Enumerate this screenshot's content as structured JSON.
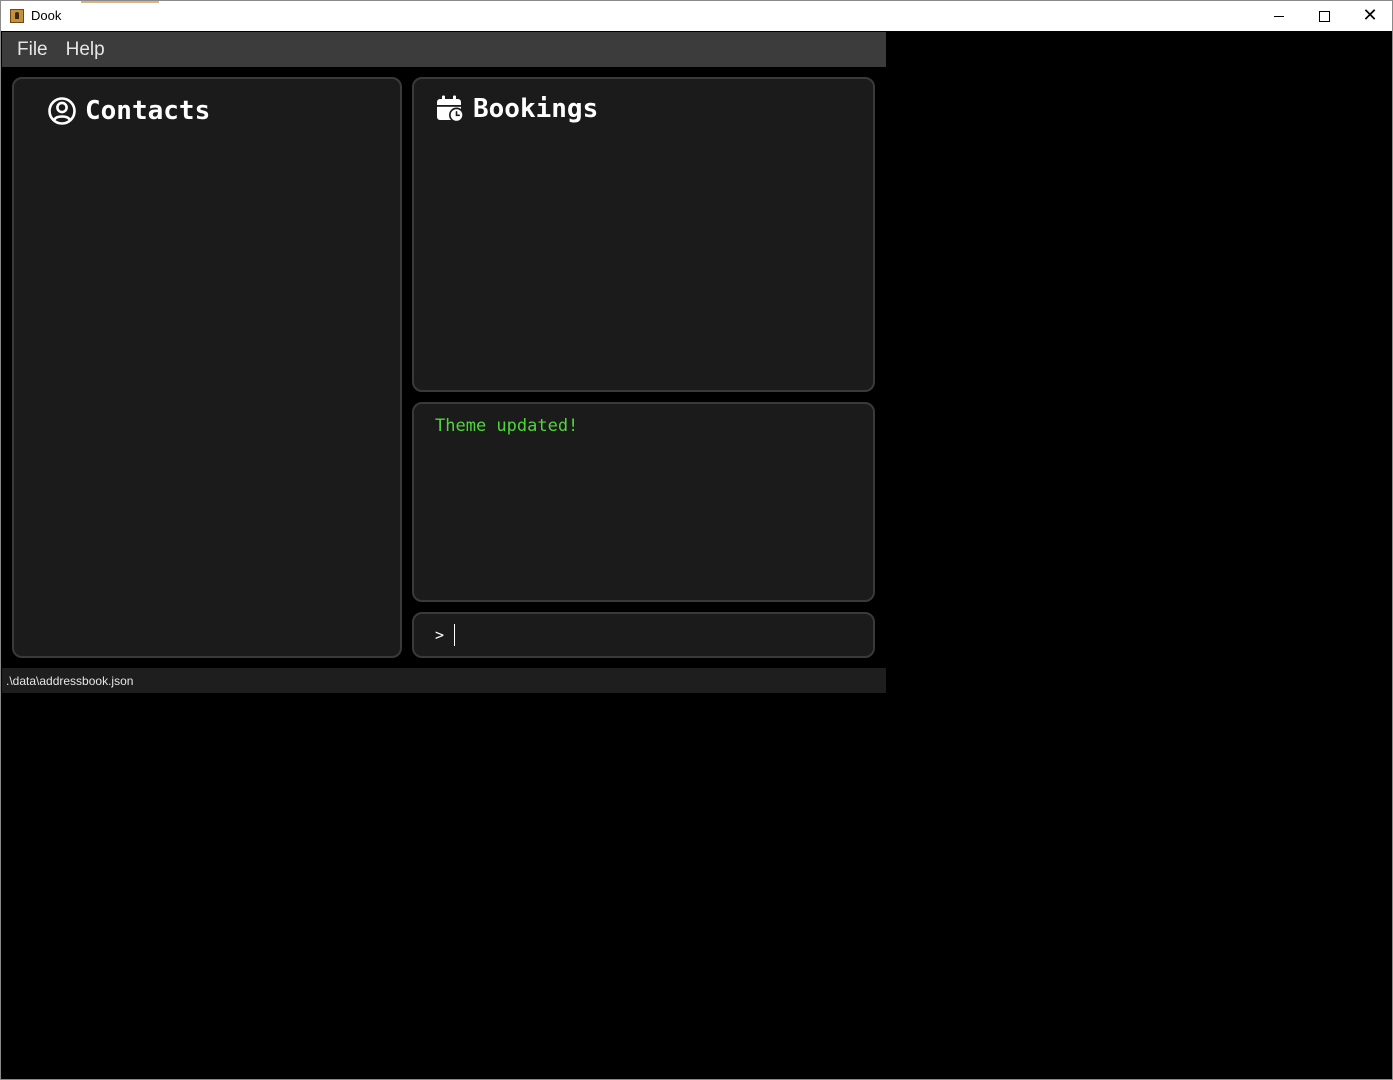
{
  "window": {
    "title": "Dook"
  },
  "menu": {
    "items": [
      {
        "label": "File"
      },
      {
        "label": "Help"
      }
    ]
  },
  "contacts": {
    "title": "Contacts",
    "icon": "user-circle-icon"
  },
  "bookings": {
    "title": "Bookings",
    "icon": "calendar-clock-icon"
  },
  "result": {
    "message": "Theme updated!"
  },
  "command": {
    "prompt": ">",
    "value": ""
  },
  "status": {
    "file_path": ".\\data\\addressbook.json"
  },
  "colors": {
    "background": "#000000",
    "panel": "#1b1b1b",
    "panel_border": "#3a3a3a",
    "menubar": "#3c3c3c",
    "result_text": "#4fd63a",
    "text": "#ffffff"
  }
}
